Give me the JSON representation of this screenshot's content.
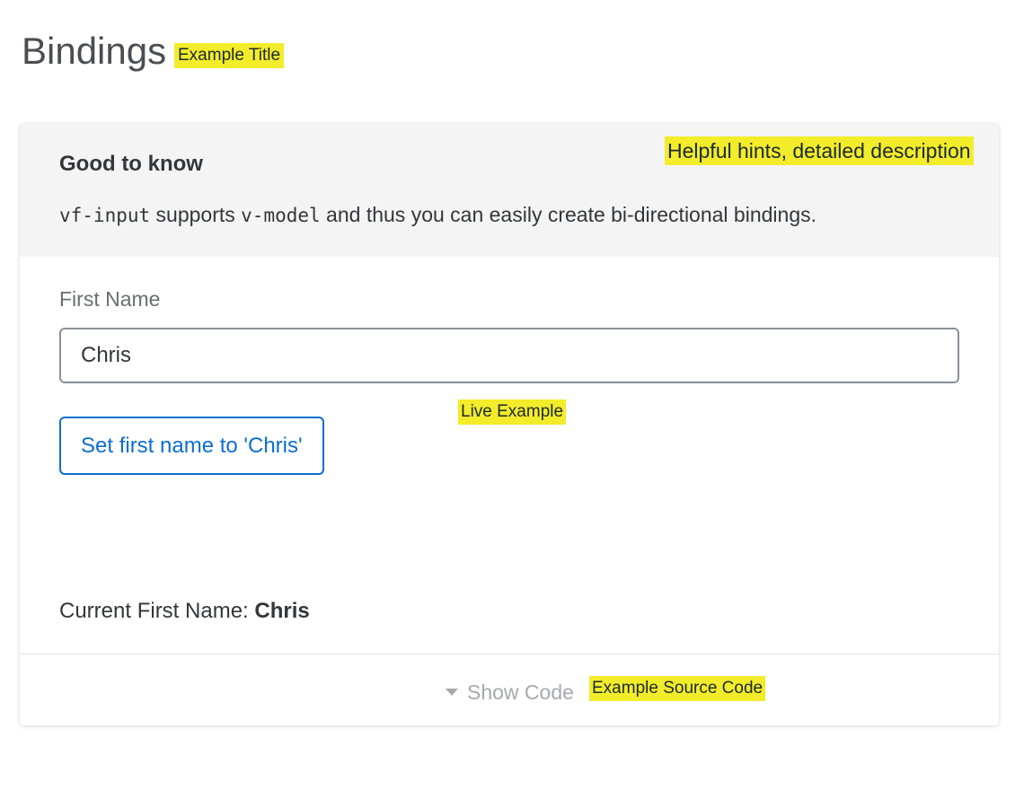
{
  "page": {
    "title": "Bindings"
  },
  "annotations": {
    "title": "Example Title",
    "hints": "Helpful hints, detailed description",
    "live": "Live Example",
    "source": "Example Source Code"
  },
  "hint": {
    "heading": "Good to know",
    "code_component": "vf-input",
    "text_part1": " supports ",
    "code_directive": "v-model",
    "text_part2": " and thus you can easily create bi-directional bindings."
  },
  "form": {
    "first_name_label": "First Name",
    "first_name_value": "Chris",
    "set_button_label": "Set first name to 'Chris'",
    "current_label": "Current First Name: ",
    "current_value": "Chris"
  },
  "footer": {
    "show_code_label": "Show Code",
    "toggle_icon": "caret-down-icon"
  },
  "colors": {
    "accent": "#0a6ed1",
    "annotation_highlight": "#f3ec2a",
    "hint_background": "#f4f4f4"
  }
}
